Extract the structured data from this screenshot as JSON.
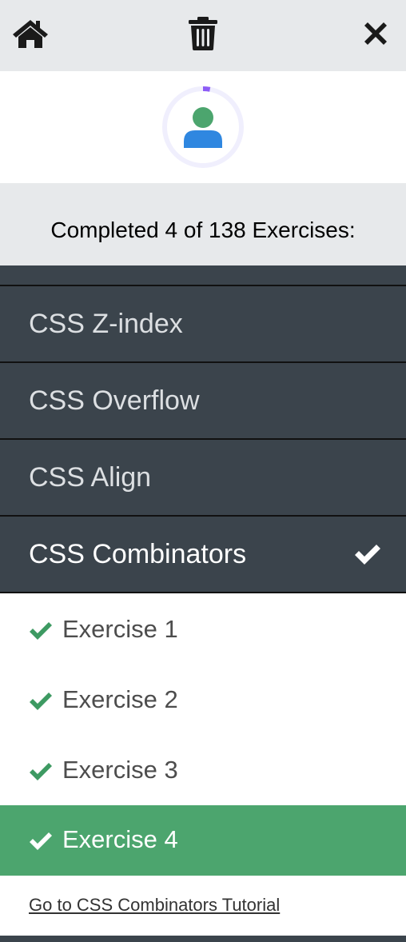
{
  "topbar": {
    "icons": [
      "home-icon",
      "trash-icon",
      "close-icon"
    ]
  },
  "progress": {
    "completed_text": "Completed 4 of 138 Exercises:",
    "completed": 4,
    "total": 138,
    "ring_color": "#8d5cf6"
  },
  "chapters": [
    {
      "label": "CSS Z-index",
      "completed": false
    },
    {
      "label": "CSS Overflow",
      "completed": false
    },
    {
      "label": "CSS Align",
      "completed": false
    },
    {
      "label": "CSS Combinators",
      "completed": true,
      "active": true
    }
  ],
  "exercises": [
    {
      "label": "Exercise 1",
      "completed": true
    },
    {
      "label": "Exercise 2",
      "completed": true
    },
    {
      "label": "Exercise 3",
      "completed": true
    },
    {
      "label": "Exercise 4",
      "completed": true,
      "active": true
    }
  ],
  "tutorial_link": "Go to CSS Combinators Tutorial",
  "colors": {
    "accent_green": "#4ca56e",
    "check_green": "#3d9a62",
    "dark_panel": "#3b444c",
    "light_bar": "#e7e9eb"
  }
}
